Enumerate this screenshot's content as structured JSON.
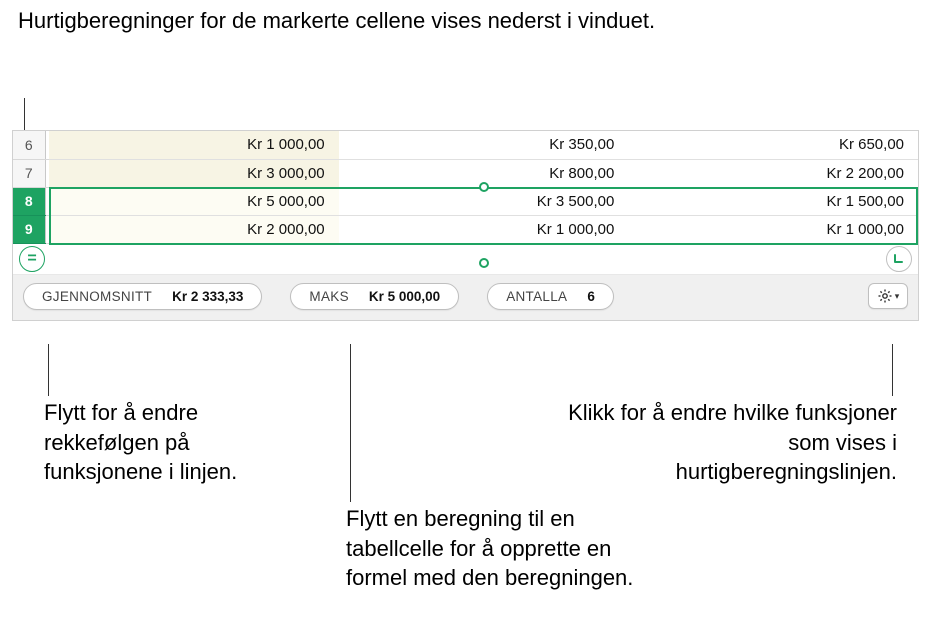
{
  "callouts": {
    "top": "Hurtigberegninger for de markerte cellene vises nederst i vinduet.",
    "bottom_left": "Flytt for å endre rekkefølgen på funksjonene i linjen.",
    "bottom_middle": "Flytt en beregning til en tabellcelle for å opprette en formel med den beregningen.",
    "bottom_right": "Klikk for å endre hvilke funksjoner som vises i hurtigberegningslinjen."
  },
  "icons": {
    "equals": "=",
    "gear": "gear-icon",
    "chevron": "▾"
  },
  "table": {
    "rows": [
      {
        "num": "6",
        "selected": false,
        "c1": "Kr 1 000,00",
        "c2": "Kr 350,00",
        "c3": "Kr 650,00"
      },
      {
        "num": "7",
        "selected": false,
        "c1": "Kr 3 000,00",
        "c2": "Kr 800,00",
        "c3": "Kr 2 200,00"
      },
      {
        "num": "8",
        "selected": true,
        "c1": "Kr 5 000,00",
        "c2": "Kr 3 500,00",
        "c3": "Kr 1 500,00"
      },
      {
        "num": "9",
        "selected": true,
        "c1": "Kr 2 000,00",
        "c2": "Kr 1 000,00",
        "c3": "Kr 1 000,00"
      }
    ]
  },
  "calcbar": {
    "items": [
      {
        "label": "GJENNOMSNITT",
        "value": "Kr 2 333,33"
      },
      {
        "label": "MAKS",
        "value": "Kr 5 000,00"
      },
      {
        "label": "ANTALLA",
        "value": "6"
      }
    ]
  }
}
